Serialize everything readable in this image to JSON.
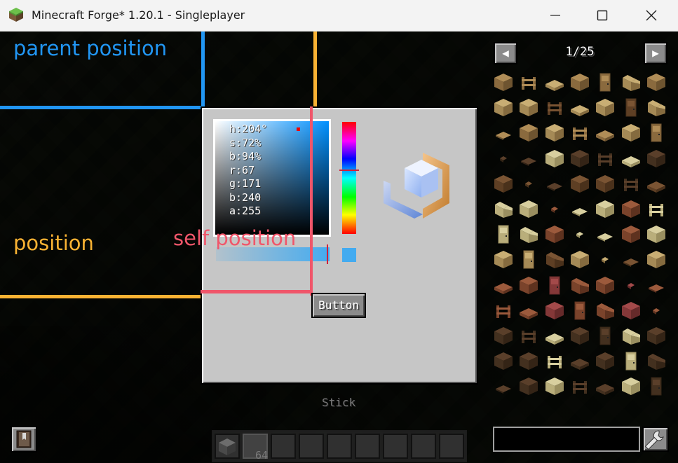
{
  "window": {
    "title": "Minecraft Forge* 1.20.1 - Singleplayer",
    "icon": "grass-block-icon"
  },
  "annotations": {
    "parent_position": "parent position",
    "position": "position",
    "self_position": "self position",
    "colors": {
      "parent": "#2196f3",
      "position": "#f9b233",
      "self": "#f0566a"
    }
  },
  "color_picker": {
    "readout": [
      "h:204°",
      "s:72%",
      "b:94%",
      "r:67",
      "g:171",
      "b:240",
      "a:255"
    ],
    "selected_color": "#43abf0"
  },
  "button": {
    "label": "Button"
  },
  "item_list": {
    "prev_label": "◀",
    "next_label": "▶",
    "page": "1/25"
  },
  "hud": {
    "held_item": "Stick",
    "hotbar_count": "64"
  }
}
